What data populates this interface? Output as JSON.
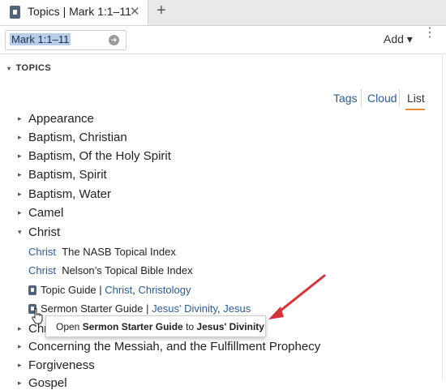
{
  "tab": {
    "title": "Topics | Mark 1:1–11",
    "close_label": "✕",
    "add_label": "+",
    "icon": "book-icon"
  },
  "toolbar": {
    "reference": "Mark 1:1–11",
    "go_icon": "arrow-right-icon",
    "add_label": "Add ▾",
    "menu_icon": "vertical-dots-icon"
  },
  "section": {
    "caret": "▾",
    "title": "TOPICS"
  },
  "views": {
    "tags": "Tags",
    "cloud": "Cloud",
    "list": "List",
    "active": "List",
    "accent": "#e58b3a"
  },
  "topics_before": [
    {
      "caret": "▸",
      "label": "Appearance"
    },
    {
      "caret": "▸",
      "label": "Baptism, Christian"
    },
    {
      "caret": "▸",
      "label": "Baptism, Of the Holy Spirit"
    },
    {
      "caret": "▸",
      "label": "Baptism, Spirit"
    },
    {
      "caret": "▸",
      "label": "Baptism, Water"
    },
    {
      "caret": "▸",
      "label": "Camel"
    },
    {
      "caret": "▾",
      "label": "Christ"
    }
  ],
  "christ_entries": [
    {
      "term": "Christ",
      "source": "The NASB Topical Index"
    },
    {
      "term": "Christ",
      "source": "Nelson’s Topical Bible Index"
    }
  ],
  "guides": [
    {
      "name": "Topic Guide",
      "sep": " | ",
      "links": [
        "Christ",
        "Christology"
      ],
      "link_sep": ", "
    },
    {
      "name": "Sermon Starter Guide",
      "sep": " | ",
      "links": [
        "Jesus' Divinity",
        "Jesus"
      ],
      "link_sep": ", "
    }
  ],
  "tooltip": {
    "prefix": "Open ",
    "guide": "Sermon Starter Guide",
    "middle": " to ",
    "target": "Jesus' Divinity"
  },
  "topics_after": [
    {
      "caret": "▸",
      "label": "Chri"
    },
    {
      "caret": "▸",
      "label": "Concerning the Messiah, and the Fulfillment Prophecy"
    },
    {
      "caret": "▸",
      "label": "Forgiveness"
    },
    {
      "caret": "▸",
      "label": "Gospel"
    }
  ],
  "annotation": {
    "color": "#d9333a"
  }
}
